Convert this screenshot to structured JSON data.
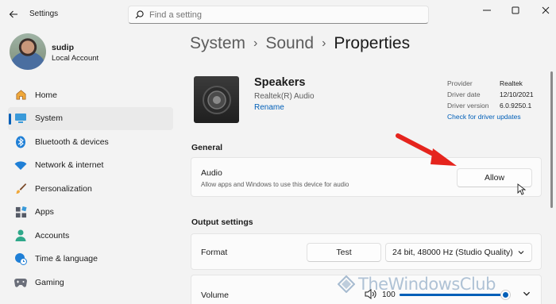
{
  "app": {
    "title": "Settings"
  },
  "search": {
    "placeholder": "Find a setting"
  },
  "user": {
    "name": "sudip",
    "account_type": "Local Account"
  },
  "nav": {
    "items": [
      {
        "label": "Home",
        "icon": "home-icon",
        "active": false
      },
      {
        "label": "System",
        "icon": "monitor-icon",
        "active": true
      },
      {
        "label": "Bluetooth & devices",
        "icon": "bluetooth-icon",
        "active": false
      },
      {
        "label": "Network & internet",
        "icon": "wifi-icon",
        "active": false
      },
      {
        "label": "Personalization",
        "icon": "brush-icon",
        "active": false
      },
      {
        "label": "Apps",
        "icon": "apps-icon",
        "active": false
      },
      {
        "label": "Accounts",
        "icon": "person-icon",
        "active": false
      },
      {
        "label": "Time & language",
        "icon": "globe-clock-icon",
        "active": false
      },
      {
        "label": "Gaming",
        "icon": "gamepad-icon",
        "active": false
      }
    ]
  },
  "breadcrumb": {
    "part1": "System",
    "part2": "Sound",
    "current": "Properties"
  },
  "device": {
    "name": "Speakers",
    "subtitle": "Realtek(R) Audio",
    "rename_label": "Rename",
    "provider_label": "Provider",
    "provider_value": "Realtek",
    "date_label": "Driver date",
    "date_value": "12/10/2021",
    "version_label": "Driver version",
    "version_value": "6.0.9250.1",
    "check_updates": "Check for driver updates"
  },
  "general": {
    "heading": "General",
    "audio_title": "Audio",
    "audio_desc": "Allow apps and Windows to use this device for audio",
    "allow_label": "Allow"
  },
  "output": {
    "heading": "Output settings",
    "format_label": "Format",
    "test_label": "Test",
    "format_value": "24 bit, 48000 Hz (Studio Quality)",
    "volume_label": "Volume",
    "volume_value": "100",
    "volume_fraction": 1.0
  },
  "watermark": {
    "text": "TheWindowsClub"
  },
  "colors": {
    "accent": "#005fb8",
    "arrow": "#e5241d",
    "background": "#f3f3f3"
  }
}
